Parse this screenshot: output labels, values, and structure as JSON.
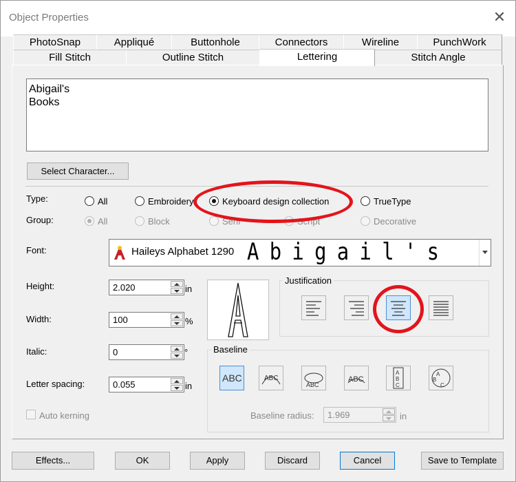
{
  "window": {
    "title": "Object Properties",
    "close": "✕"
  },
  "tabs_row1": [
    "PhotoSnap",
    "Appliqué",
    "Buttonhole",
    "Connectors",
    "Wireline",
    "PunchWork"
  ],
  "tabs_row2": [
    "Fill Stitch",
    "Outline Stitch",
    "Lettering",
    "Stitch Angle"
  ],
  "active_tab": "Lettering",
  "text_value": "Abigail's\nBooks",
  "select_character": "Select Character...",
  "type": {
    "label": "Type:",
    "options": [
      "All",
      "Embroidery",
      "Keyboard design collection",
      "TrueType"
    ],
    "selected": "Keyboard design collection"
  },
  "group": {
    "label": "Group:",
    "options": [
      "All",
      "Block",
      "Serif",
      "Script",
      "Decorative"
    ],
    "selected": "All"
  },
  "font": {
    "label": "Font:",
    "name": "Haileys Alphabet 1290",
    "preview": "Abigail's"
  },
  "height": {
    "label": "Height:",
    "value": "2.020",
    "unit": "in"
  },
  "width": {
    "label": "Width:",
    "value": "100",
    "unit": "%"
  },
  "italic": {
    "label": "Italic:",
    "value": "0",
    "unit": "°"
  },
  "letter_spacing": {
    "label": "Letter spacing:",
    "value": "0.055",
    "unit": "in"
  },
  "auto_kerning": {
    "label": "Auto kerning",
    "checked": false
  },
  "justification": {
    "title": "Justification",
    "options": [
      "left",
      "right",
      "center",
      "full"
    ],
    "selected": "center"
  },
  "baseline": {
    "title": "Baseline",
    "options": [
      "straight",
      "arc-top",
      "arc-bottom",
      "circle",
      "vertical",
      "circle-outline"
    ],
    "selected": "straight",
    "radius_label": "Baseline radius:",
    "radius_value": "1.969",
    "radius_unit": "in"
  },
  "buttons": {
    "effects": "Effects...",
    "ok": "OK",
    "apply": "Apply",
    "discard": "Discard",
    "cancel": "Cancel",
    "save_template": "Save to Template"
  },
  "colors": {
    "highlight": "#e3141b",
    "selected_bg": "#cfe6fb"
  }
}
